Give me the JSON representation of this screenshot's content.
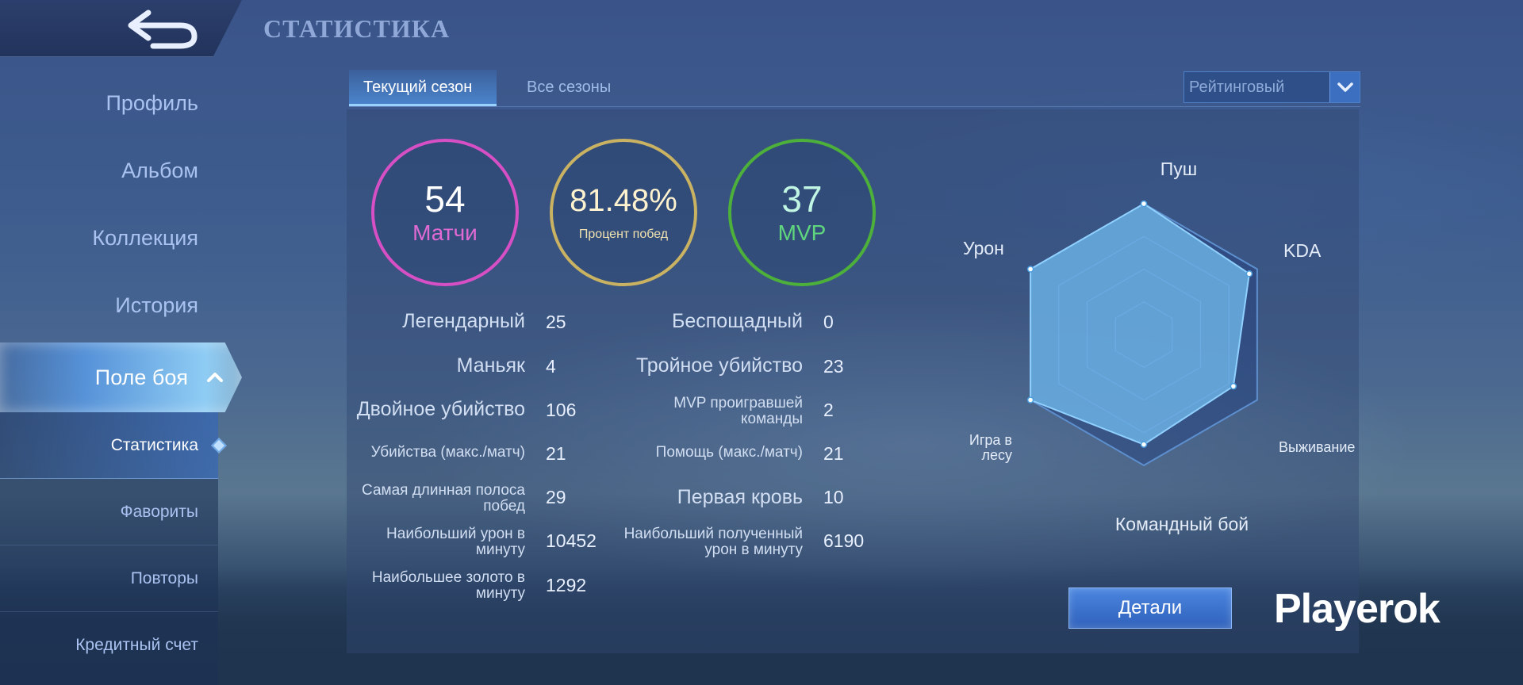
{
  "header": {
    "title": "СТАТИСТИКА"
  },
  "sidebar": {
    "items": [
      {
        "label": "Профиль"
      },
      {
        "label": "Альбом"
      },
      {
        "label": "Коллекция"
      },
      {
        "label": "История"
      }
    ],
    "active_section": "Поле боя",
    "sub_items": [
      {
        "label": "Статистика",
        "selected": true
      },
      {
        "label": "Фавориты",
        "selected": false
      },
      {
        "label": "Повторы",
        "selected": false
      },
      {
        "label": "Кредитный счет",
        "selected": false
      }
    ]
  },
  "tabs": [
    {
      "label": "Текущий сезон",
      "active": true
    },
    {
      "label": "Все сезоны",
      "active": false
    }
  ],
  "mode_select": {
    "value": "Рейтинговый"
  },
  "summary": {
    "matches": {
      "value": "54",
      "label": "Матчи",
      "color": "#d64fc4"
    },
    "win_rate": {
      "value": "81.48%",
      "label": "Процент побед",
      "color": "#c9b262"
    },
    "mvp": {
      "value": "37",
      "label": "MVP",
      "color": "#4cb03a"
    }
  },
  "stats_left": [
    {
      "label": "Легендарный",
      "value": "25"
    },
    {
      "label": "Маньяк",
      "value": "4"
    },
    {
      "label": "Двойное убийство",
      "value": "106"
    },
    {
      "label": "Убийства (макс./матч)",
      "value": "21"
    },
    {
      "label": "Самая длинная полоса побед",
      "value": "29"
    },
    {
      "label": "Наибольший урон в минуту",
      "value": "10452"
    },
    {
      "label": "Наибольшее золото в минуту",
      "value": "1292"
    }
  ],
  "stats_right": [
    {
      "label": "Беспощадный",
      "value": "0"
    },
    {
      "label": "Тройное убийство",
      "value": "23"
    },
    {
      "label": "MVP проигравшей команды",
      "value": "2"
    },
    {
      "label": "Помощь (макс./матч)",
      "value": "21"
    },
    {
      "label": "Первая кровь",
      "value": "10"
    },
    {
      "label": "Наибольший полученный урон в минуту",
      "value": "6190"
    }
  ],
  "radar": {
    "axes": [
      {
        "label": "Пуш",
        "value": 1.0
      },
      {
        "label": "KDA",
        "value": 0.93
      },
      {
        "label": "Выживание",
        "value": 0.79
      },
      {
        "label": "Командный бой",
        "value": 0.84
      },
      {
        "label": "Игра в лесу",
        "value": 1.0
      },
      {
        "label": "Урон",
        "value": 1.0
      }
    ],
    "fill_color": "#6fb7e8",
    "outline_color": "#5d8fcf"
  },
  "details_button": {
    "label": "Детали"
  },
  "watermark": {
    "text": "Playerok"
  }
}
